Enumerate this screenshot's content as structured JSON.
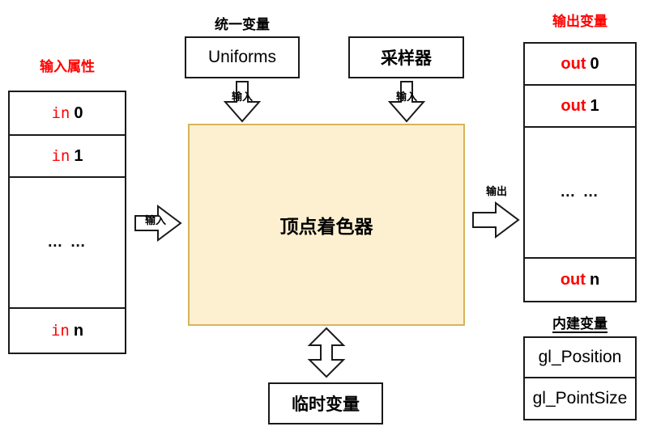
{
  "diagram": {
    "title_implicit": "顶点着色器数据流",
    "input_attributes": {
      "header": "输入属性",
      "header_color": "#FF0000",
      "cells": [
        {
          "keyword": "in",
          "value": "0"
        },
        {
          "keyword": "in",
          "value": "1"
        },
        {
          "keyword": "",
          "value": "… …"
        },
        {
          "keyword": "in",
          "value": "n"
        }
      ]
    },
    "uniforms": {
      "header": "统一变量",
      "header_color": "#000000",
      "box_label": "Uniforms",
      "arrow_label": "输入"
    },
    "sampler": {
      "box_label": "采样器",
      "arrow_label": "输入"
    },
    "shader": {
      "label": "顶点着色器",
      "fill_color": "#FCF0D0",
      "border_color": "#D6B45C"
    },
    "input_arrow": {
      "label": "输入"
    },
    "output_arrow": {
      "label": "输出"
    },
    "temp_variables": {
      "box_label": "临时变量"
    },
    "output_variables": {
      "header": "输出变量",
      "header_color": "#FF0000",
      "cells": [
        {
          "keyword": "out",
          "value": "0"
        },
        {
          "keyword": "out",
          "value": "1"
        },
        {
          "keyword": "",
          "value": "… …"
        },
        {
          "keyword": "out",
          "value": "n"
        }
      ]
    },
    "builtin_variables": {
      "header": "内建变量",
      "header_color": "#000000",
      "items": [
        "gl_Position",
        "gl_PointSize"
      ]
    }
  }
}
